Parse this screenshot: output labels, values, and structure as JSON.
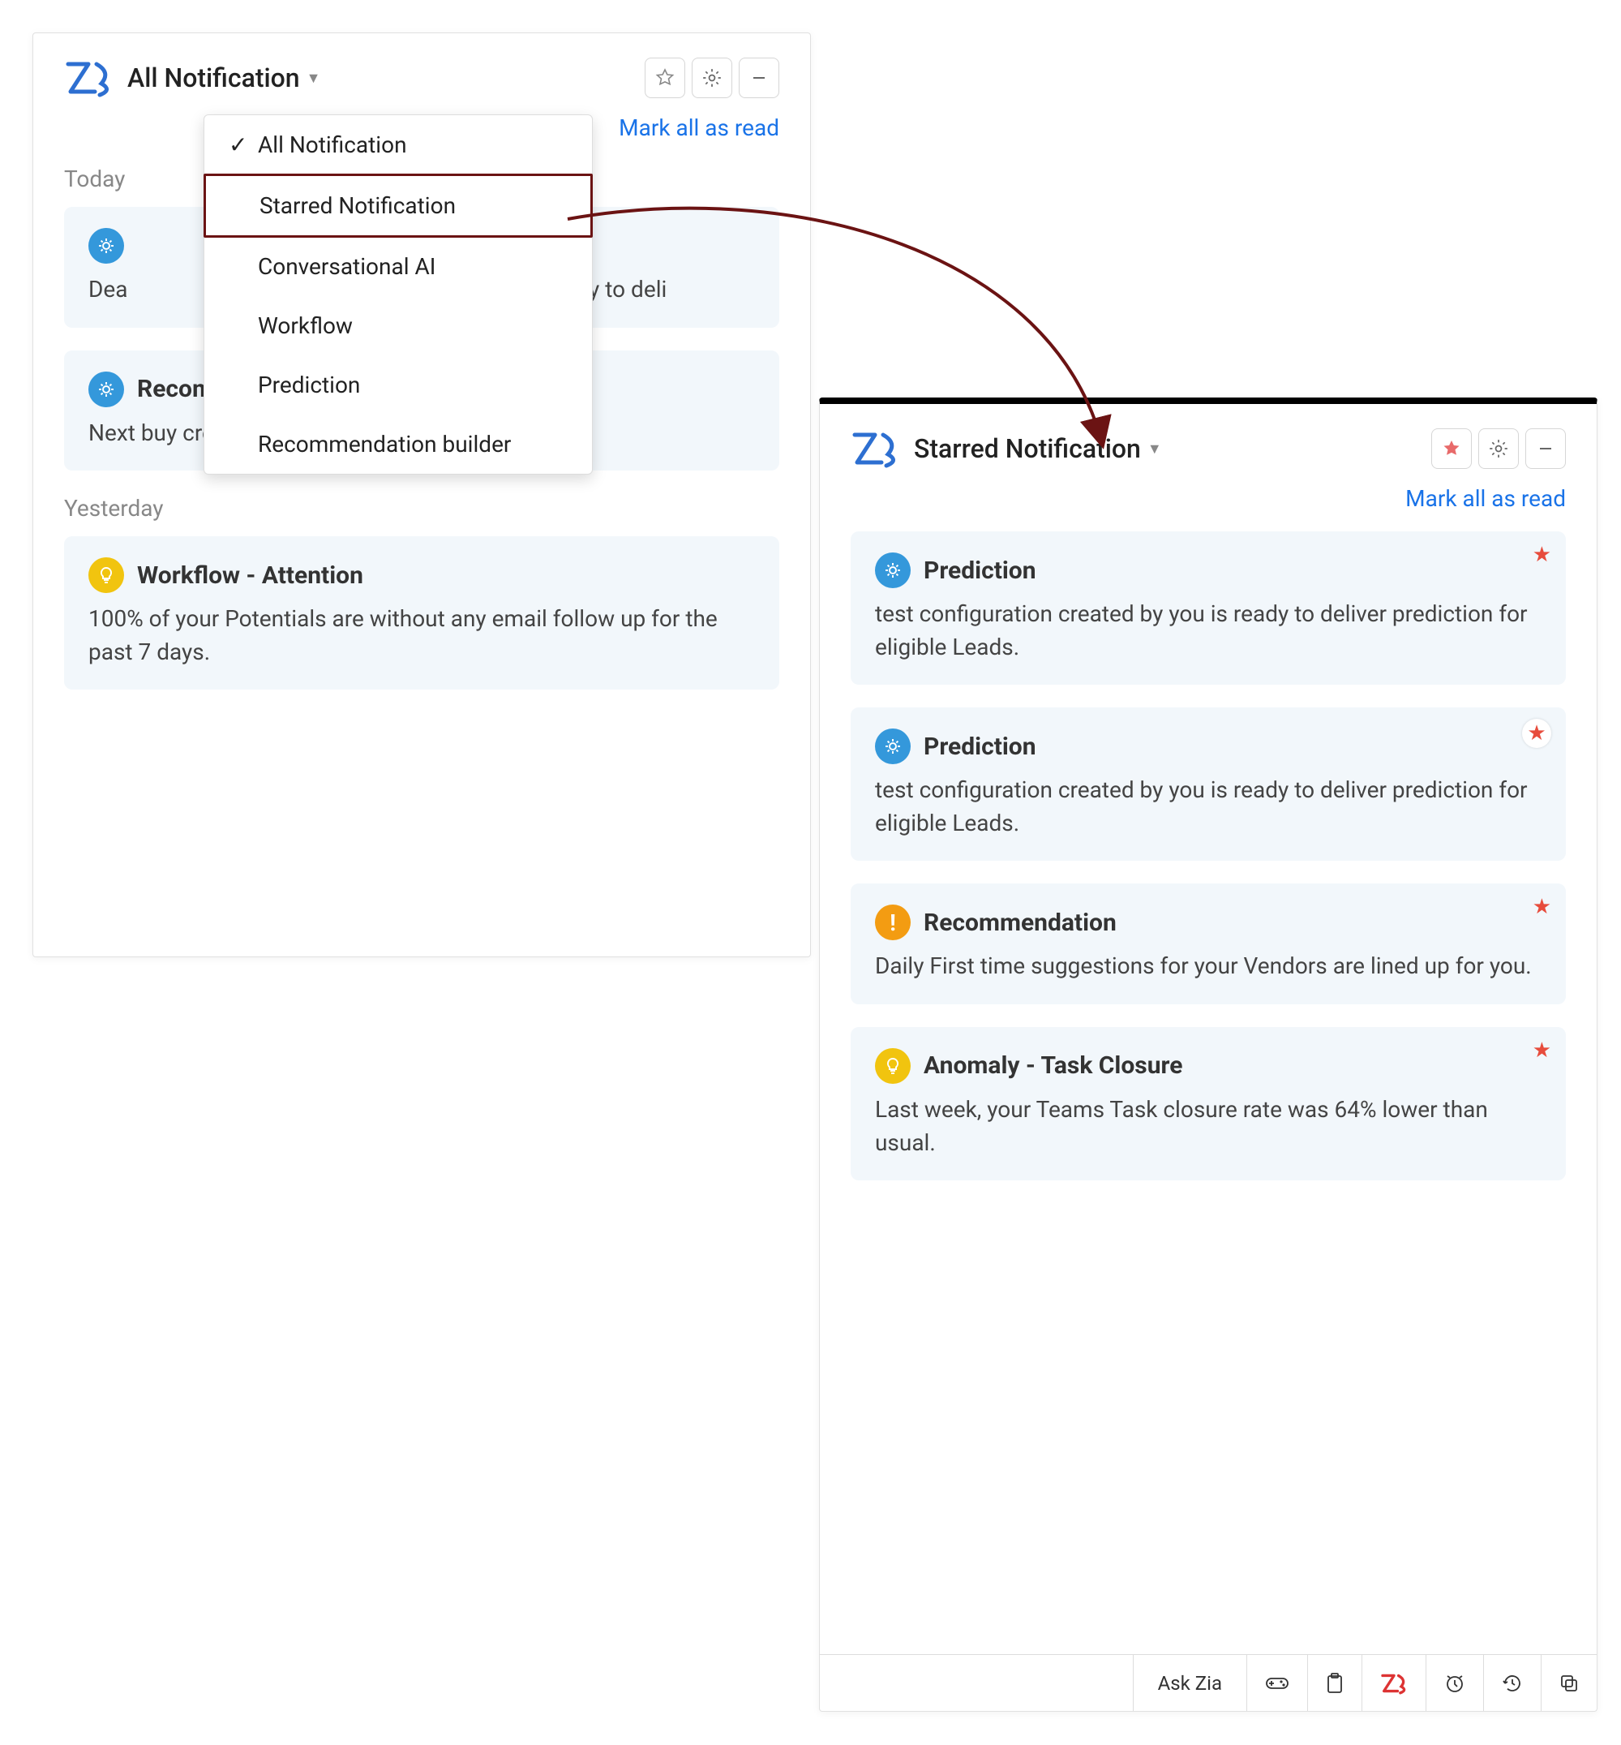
{
  "left": {
    "title": "All Notification",
    "mark_read": "Mark all as read",
    "dropdown": {
      "items": [
        {
          "label": "All Notification",
          "checked": true
        },
        {
          "label": "Starred Notification",
          "selected": true
        },
        {
          "label": "Conversational AI"
        },
        {
          "label": "Workflow"
        },
        {
          "label": "Prediction"
        },
        {
          "label": "Recommendation builder"
        }
      ]
    },
    "sections": [
      {
        "label": "Today",
        "cards": [
          {
            "icon": "gear",
            "title": "",
            "body_prefix": "Dea",
            "body_suffix": "you is ready to deli"
          },
          {
            "icon": "gear",
            "title": "Recommendation builder",
            "body": "Next buy created by you is ready to be used."
          }
        ]
      },
      {
        "label": "Yesterday",
        "cards": [
          {
            "icon": "bulb",
            "title": "Workflow - Attention",
            "body": "100% of your Potentials are without any email follow up for the past 7 days."
          }
        ]
      }
    ]
  },
  "right": {
    "title": "Starred Notification",
    "mark_read": "Mark all as read",
    "cards": [
      {
        "icon": "gear",
        "title": "Prediction",
        "body": "test configuration created by you is ready to deliver prediction for eligible Leads.",
        "star": "plain"
      },
      {
        "icon": "gear",
        "title": "Prediction",
        "body": "test configuration created by you is ready to deliver prediction for eligible Leads.",
        "star": "chip"
      },
      {
        "icon": "exclaim",
        "title": "Recommendation",
        "body": "Daily First time suggestions for your Vendors are lined up for you.",
        "star": "plain"
      },
      {
        "icon": "bulb",
        "title": "Anomaly - Task Closure",
        "body": "Last week, your Teams Task closure rate was 64% lower than usual.",
        "star": "plain"
      }
    ],
    "bottom_bar": {
      "ask": "Ask Zia",
      "zia_icon": "Zia"
    }
  }
}
